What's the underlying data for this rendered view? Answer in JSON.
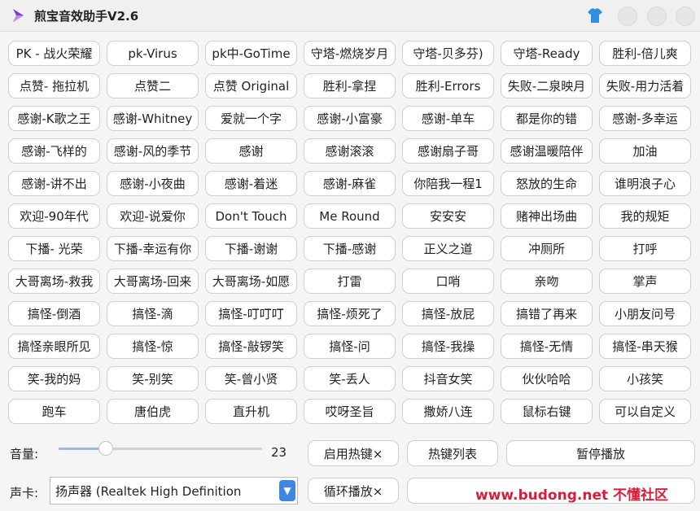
{
  "window": {
    "title": "煎宝音效助手V2.6"
  },
  "sound_buttons": [
    "PK - 战火荣耀",
    "pk-Virus",
    "pk中-GoTime",
    "守塔-燃烧岁月",
    "守塔-贝多芬)",
    "守塔-Ready",
    "胜利-倍儿爽",
    "点赞- 拖拉机",
    "点赞二",
    "点赞 Original",
    "胜利-拿捏",
    "胜利-Errors",
    "失败-二泉映月",
    "失败-用力活着",
    "感谢-K歌之王",
    "感谢-Whitney",
    "爱就一个字",
    "感谢-小富豪",
    "感谢-单车",
    "都是你的错",
    "感谢-多幸运",
    "感谢-飞样的",
    "感谢-风的季节",
    "感谢",
    "感谢滚滚",
    "感谢扇子哥",
    "感谢温暖陪伴",
    "加油",
    "感谢-讲不出",
    "感谢-小夜曲",
    "感谢-着迷",
    "感谢-麻雀",
    "你陪我一程1",
    "怒放的生命",
    "谁明浪子心",
    "欢迎-90年代",
    "欢迎-说爱你",
    "Don't Touch",
    "Me Round",
    "安安安",
    "赌神出场曲",
    "我的规矩",
    "下播- 光荣",
    "下播-幸运有你",
    "下播-谢谢",
    "下播-感谢",
    "正义之道",
    "冲厕所",
    "打呼",
    "大哥离场-救我",
    "大哥离场-回来",
    "大哥离场-如愿",
    "打雷",
    "口哨",
    "亲吻",
    "掌声",
    "搞怪-倒酒",
    "搞怪-滴",
    "搞怪-叮叮叮",
    "搞怪-烦死了",
    "搞怪-放屁",
    "搞错了再来",
    "小朋友问号",
    "搞怪亲眼所见",
    "搞怪-惊",
    "搞怪-敲锣笑",
    "搞怪-问",
    "搞怪-我操",
    "搞怪-无情",
    "搞怪-串天猴",
    "笑-我的妈",
    "笑-别笑",
    "笑-曾小贤",
    "笑-丢人",
    "抖音女笑",
    "伙伙哈哈",
    "小孩笑",
    "跑车",
    "唐伯虎",
    "直升机",
    "哎呀圣旨",
    "撒娇八连",
    "鼠标右键",
    "可以自定义"
  ],
  "volume": {
    "label": "音量:",
    "value": "23",
    "level": 0.23
  },
  "controls": {
    "hotkey_enable": "启用热键×",
    "hotkey_list": "热键列表",
    "pause": "暂停播放",
    "loop": "循环播放×",
    "sound_card_label": "声卡:",
    "sound_card_value": "扬声器 (Realtek High Definition"
  },
  "watermark": "www.budong.net 不懂社区",
  "colors": {
    "accent": "#3e86e6",
    "watermark": "#d81e3a"
  }
}
